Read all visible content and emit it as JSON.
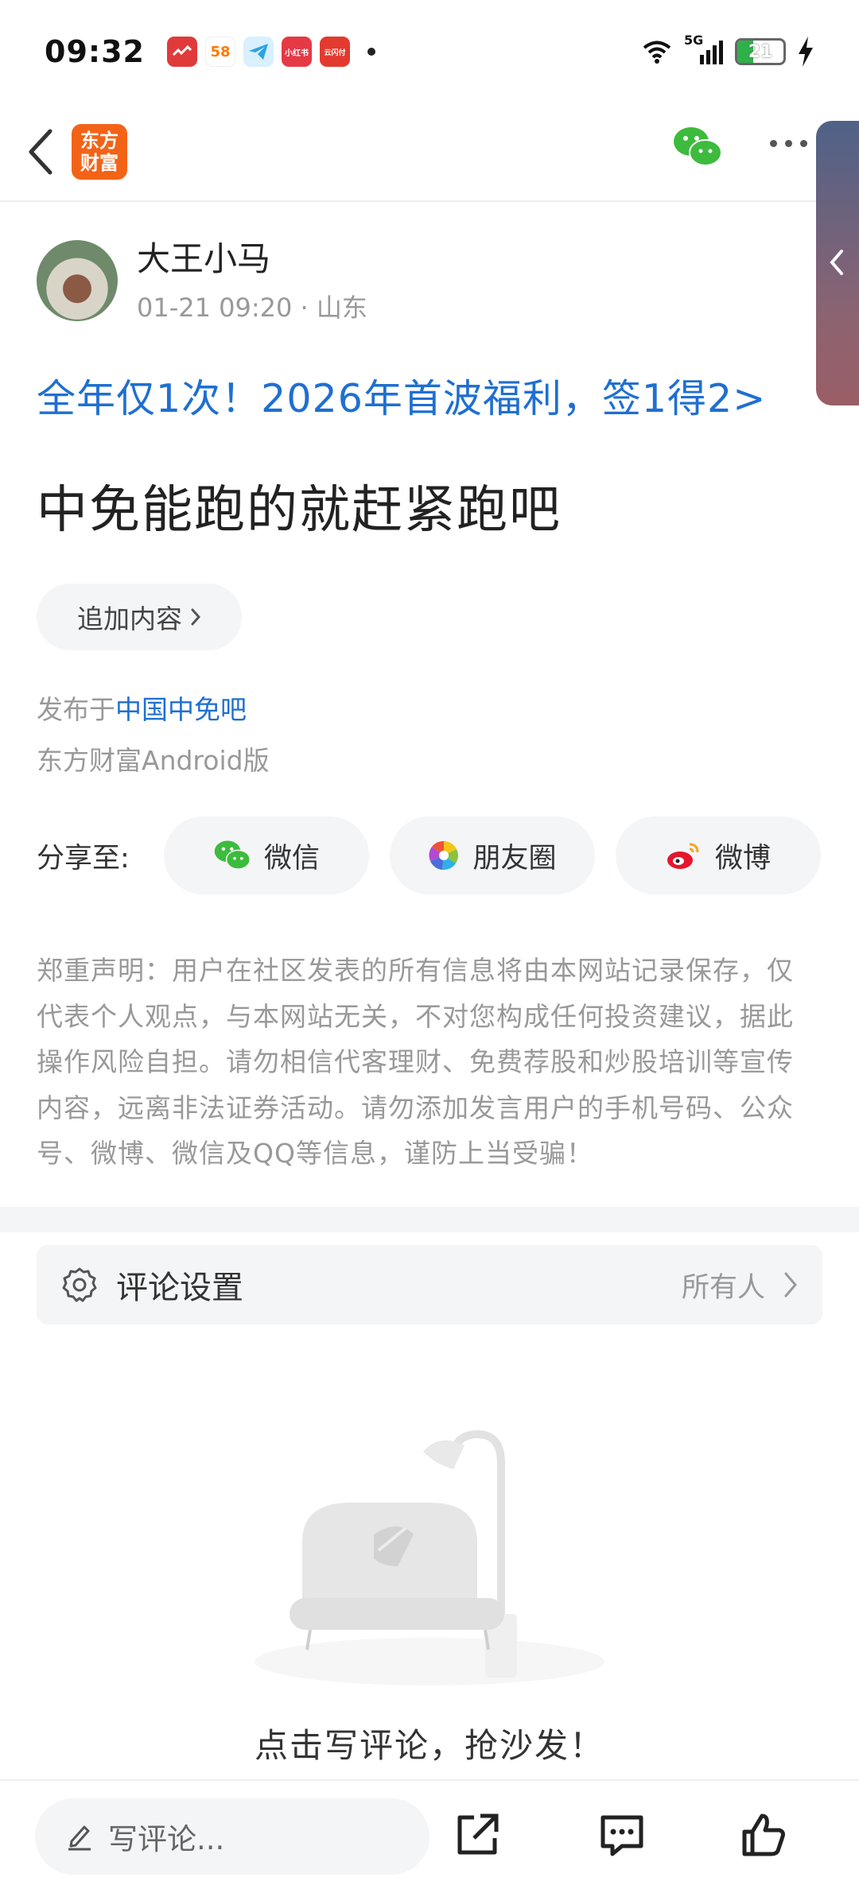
{
  "status_bar": {
    "time": "09:32",
    "battery_level": "21",
    "network": "5G",
    "apps": [
      {
        "name": "app-red",
        "label": "",
        "color": "#e03a3a"
      },
      {
        "name": "app-58",
        "label": "58",
        "color": "#ff7a00"
      },
      {
        "name": "app-telegram",
        "label": "",
        "color": "#2aa3e0"
      },
      {
        "name": "app-xiaohongshu",
        "label": "小红书",
        "color": "#e53946"
      },
      {
        "name": "app-yunshanfu",
        "label": "云闪付",
        "color": "#e23a2e"
      }
    ]
  },
  "header": {
    "logo_line1": "东方",
    "logo_line2": "财富",
    "logo_color": "#f36317"
  },
  "post": {
    "author_name": "大王小马",
    "author_meta": "01-21 09:20  · 山东",
    "promo": "全年仅1次！2026年首波福利，签1得2>",
    "title": "中免能跑的就赶紧跑吧",
    "append_label": "追加内容",
    "published_prefix": "发布于",
    "published_bar": "中国中免吧",
    "client": "东方财富Android版"
  },
  "share": {
    "label": "分享至:",
    "wechat": "微信",
    "moments": "朋友圈",
    "weibo": "微博"
  },
  "disclaimer": "郑重声明：用户在社区发表的所有信息将由本网站记录保存，仅代表个人观点，与本网站无关，不对您构成任何投资建议，据此操作风险自担。请勿相信代客理财、免费荐股和炒股培训等宣传内容，远离非法证券活动。请勿添加发言用户的手机号码、公众号、微博、微信及QQ等信息，谨防上当受骗！",
  "comment_settings": {
    "label": "评论设置",
    "value": "所有人"
  },
  "empty_state": {
    "text": "点击写评论，抢沙发！"
  },
  "bottom_bar": {
    "input_placeholder": "写评论..."
  },
  "colors": {
    "accent_blue": "#1f6fd1",
    "wechat_green": "#3dbb3d"
  }
}
